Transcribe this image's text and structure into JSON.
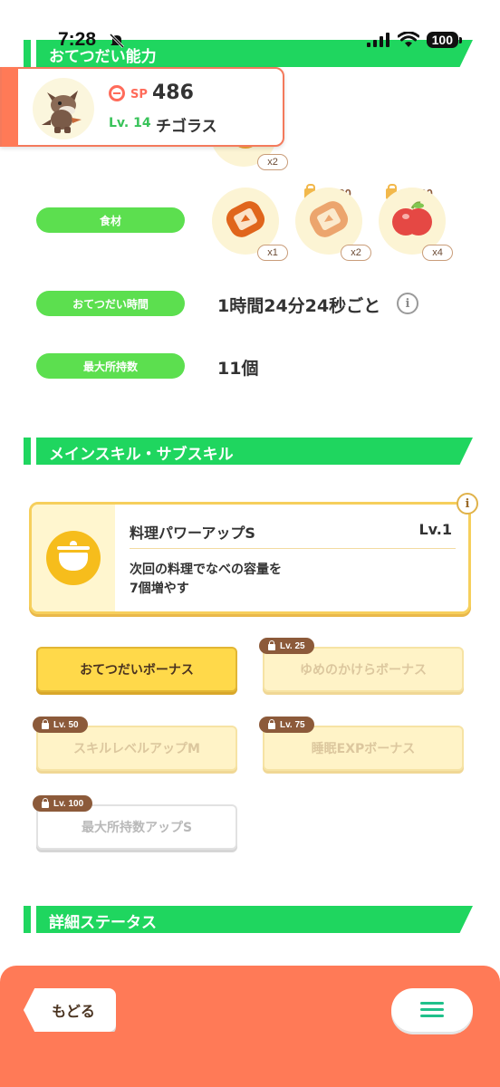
{
  "status_bar": {
    "time": "7:28",
    "battery": "100"
  },
  "sections": {
    "helping_ability": "おてつだい能力",
    "skills": "メインスキル・サブスキル",
    "detailed_status": "詳細ステータス"
  },
  "pokemon": {
    "sp_label": "SP",
    "sp_value": "486",
    "level": "Lv. 14",
    "name": "チゴラス"
  },
  "berry_row": {
    "qty": "x2"
  },
  "ingredients": {
    "label": "食材",
    "items": [
      {
        "name": "sausage",
        "qty": "x1",
        "unlock_level": ""
      },
      {
        "name": "sausage",
        "qty": "x2",
        "unlock_level": "Lv. 30"
      },
      {
        "name": "apple",
        "qty": "x4",
        "unlock_level": "Lv. 60"
      }
    ]
  },
  "help_time": {
    "label": "おてつだい時間",
    "value": "1時間24分24秒ごと"
  },
  "max_carry": {
    "label": "最大所持数",
    "value": "11個"
  },
  "main_skill": {
    "name": "料理パワーアップS",
    "level": "Lv.1",
    "desc_line1": "次回の料理でなべの容量を",
    "desc_line2": "7個増やす"
  },
  "sub_skills": [
    {
      "label": "おてつだいボーナス",
      "unlock_level": "",
      "state": "active"
    },
    {
      "label": "ゆめのかけらボーナス",
      "unlock_level": "Lv. 25",
      "state": "locked"
    },
    {
      "label": "スキルレベルアップM",
      "unlock_level": "Lv. 50",
      "state": "locked"
    },
    {
      "label": "睡眠EXPボーナス",
      "unlock_level": "Lv. 75",
      "state": "locked"
    },
    {
      "label": "最大所持数アップS",
      "unlock_level": "Lv. 100",
      "state": "locked"
    }
  ],
  "bottom": {
    "back_label": "もどる"
  },
  "colors": {
    "green": "#1fd65f",
    "pill_green": "#5cdf4f",
    "orange": "#ff7a57",
    "gold": "#ffd94a"
  }
}
